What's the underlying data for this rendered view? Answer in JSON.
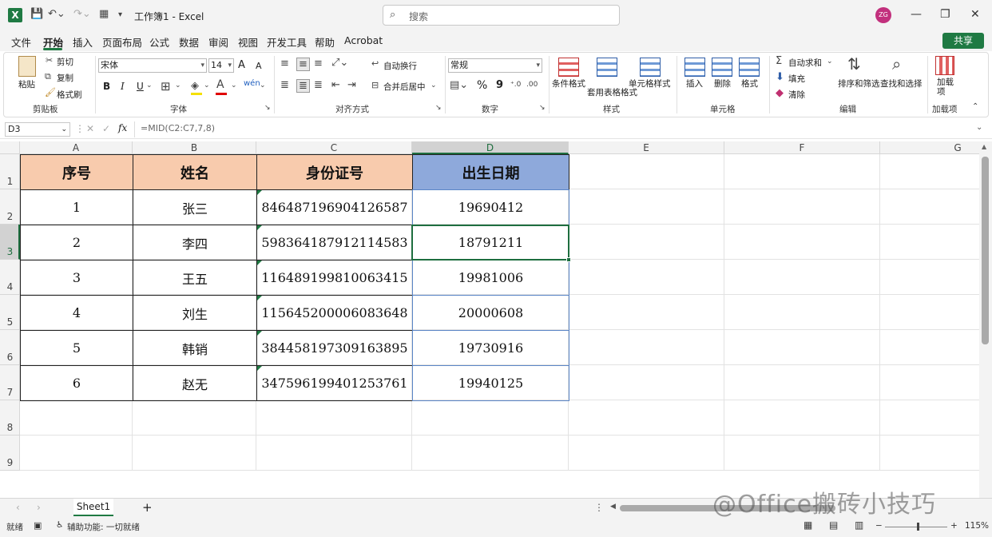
{
  "titlebar": {
    "app_logo": "X",
    "title": "工作簿1 - Excel",
    "search_placeholder": "搜索",
    "avatar": "ZG",
    "icons": {
      "save": "save-icon",
      "undo": "undo-icon",
      "redo": "redo-icon"
    }
  },
  "menu": {
    "tabs": [
      "文件",
      "开始",
      "插入",
      "页面布局",
      "公式",
      "数据",
      "审阅",
      "视图",
      "开发工具",
      "帮助",
      "Acrobat"
    ],
    "share": "共享"
  },
  "ribbon": {
    "clipboard": {
      "paste": "粘贴",
      "cut": "剪切",
      "copy": "复制",
      "format_painter": "格式刷",
      "label": "剪贴板"
    },
    "font": {
      "name": "宋体",
      "size": "14",
      "bold": "B",
      "italic": "I",
      "underline": "U",
      "label": "字体",
      "grow": "A",
      "shrink": "A"
    },
    "align": {
      "wrap": "自动换行",
      "merge": "合并后居中",
      "label": "对齐方式"
    },
    "number": {
      "format": "常规",
      "percent": "%",
      "comma": "9",
      "label": "数字"
    },
    "styles": {
      "conditional": "条件格式",
      "table": "套用表格格式",
      "cell": "单元格样式",
      "label": "样式"
    },
    "cells": {
      "insert": "插入",
      "delete": "删除",
      "format": "格式",
      "label": "单元格"
    },
    "edit": {
      "autosum": "自动求和",
      "fill": "填充",
      "clear": "清除",
      "sort": "排序和筛选",
      "find": "查找和选择",
      "label": "编辑"
    },
    "addins": {
      "addin": "加载项",
      "label": "加载项"
    }
  },
  "formula_bar": {
    "name_box": "D3",
    "fx": "fx",
    "formula": "=MID(C2:C7,7,8)"
  },
  "grid": {
    "columns": [
      "A",
      "B",
      "C",
      "D",
      "E",
      "F",
      "G"
    ],
    "rows": [
      "1",
      "2",
      "3",
      "4",
      "5",
      "6",
      "7",
      "8",
      "9"
    ],
    "header": [
      "序号",
      "姓名",
      "身份证号",
      "出生日期"
    ],
    "data": [
      [
        "1",
        "张三",
        "846487196904126587",
        "19690412"
      ],
      [
        "2",
        "李四",
        "598364187912114583",
        "18791211"
      ],
      [
        "3",
        "王五",
        "116489199810063415",
        "19981006"
      ],
      [
        "4",
        "刘生",
        "115645200006083648",
        "20000608"
      ],
      [
        "5",
        "韩销",
        "384458197309163895",
        "19730916"
      ],
      [
        "6",
        "赵无",
        "347596199401253761",
        "19940125"
      ]
    ],
    "colors": {
      "header_a_c": "#f8cbad",
      "header_d": "#8ea9db"
    }
  },
  "sheets": {
    "active": "Sheet1",
    "add": "+"
  },
  "status": {
    "ready": "就绪",
    "accessibility": "辅助功能: 一切就绪",
    "zoom": "115%"
  },
  "watermark": "@Office搬砖小技巧"
}
